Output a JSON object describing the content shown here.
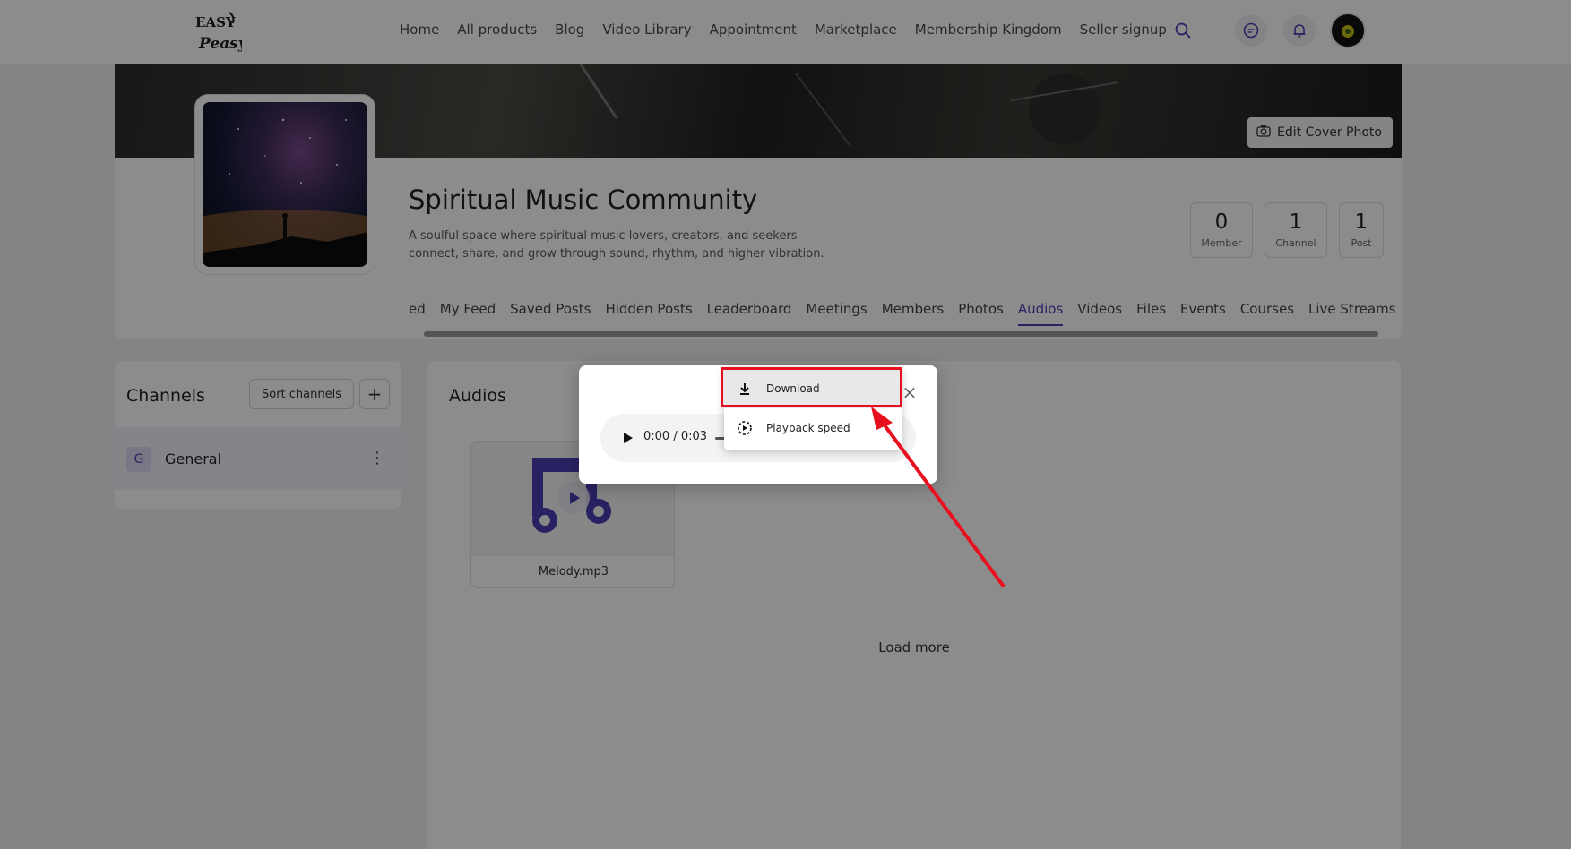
{
  "nav": {
    "logo_text": "EASY Peasy",
    "links": [
      "Home",
      "All products",
      "Blog",
      "Video Library",
      "Appointment",
      "Marketplace",
      "Membership Kingdom",
      "Seller signup"
    ],
    "icons": [
      "search-icon",
      "chat-icon",
      "bell-icon"
    ]
  },
  "profile": {
    "edit_cover": "Edit Cover Photo",
    "title": "Spiritual Music Community",
    "description": "A soulful space where spiritual music lovers, creators, and seekers connect, share, and grow through sound, rhythm, and higher vibration.",
    "stats": [
      {
        "value": "0",
        "label": "Member"
      },
      {
        "value": "1",
        "label": "Channel"
      },
      {
        "value": "1",
        "label": "Post"
      }
    ],
    "tabs": [
      "ed",
      "My Feed",
      "Saved Posts",
      "Hidden Posts",
      "Leaderboard",
      "Meetings",
      "Members",
      "Photos",
      "Audios",
      "Videos",
      "Files",
      "Events",
      "Courses",
      "Live Streams"
    ],
    "active_tab": "Audios"
  },
  "channels": {
    "title": "Channels",
    "sort_label": "Sort channels",
    "add_label": "+",
    "items": [
      {
        "badge": "G",
        "name": "General",
        "more": "⋮"
      }
    ]
  },
  "audios": {
    "title": "Audios",
    "files": [
      {
        "name": "Melody.mp3"
      }
    ],
    "load_more": "Load more"
  },
  "player": {
    "time": "0:00 / 0:03",
    "close": "×"
  },
  "context_menu": {
    "items": [
      {
        "label": "Download",
        "icon": "download-icon"
      },
      {
        "label": "Playback speed",
        "icon": "playback-speed-icon"
      }
    ]
  },
  "colors": {
    "accent": "#4a3fb5",
    "highlight": "#e8101e"
  }
}
